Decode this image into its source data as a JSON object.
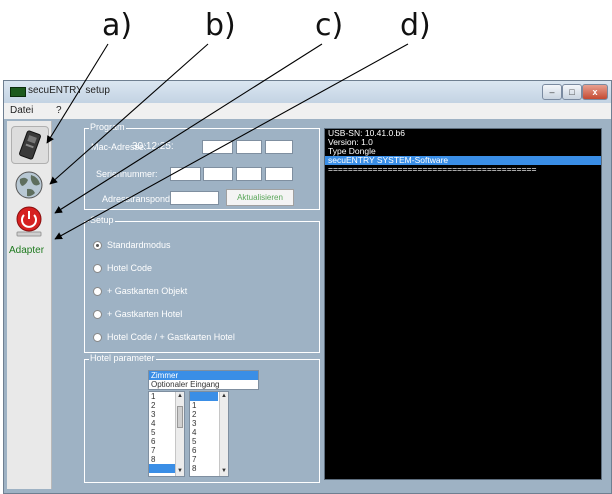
{
  "callouts": [
    "a)",
    "b)",
    "c)",
    "d)"
  ],
  "window": {
    "title": "secuENTRY setup",
    "min_label": "–",
    "max_label": "□",
    "close_label": "x"
  },
  "menu": [
    "Datei",
    "?"
  ],
  "sidebar": {
    "items": [
      {
        "icon": "dongle-icon"
      },
      {
        "icon": "globe-icon"
      },
      {
        "icon": "power-icon"
      }
    ],
    "label": "Adapter"
  },
  "programming": {
    "title": "Program",
    "mac_label": "Mac-Adresse:",
    "mac_value": "30:12:25:",
    "serial_label": "Seriennummer:",
    "transponder_label": "Adresstransponder",
    "read_button": "Aktualisieren"
  },
  "setup": {
    "title": "Setup",
    "options": [
      {
        "label": "Standardmodus",
        "checked": true
      },
      {
        "label": "Hotel Code",
        "checked": false
      },
      {
        "label": "+ Gastkarten Objekt",
        "checked": false
      },
      {
        "label": "+ Gastkarten Hotel",
        "checked": false
      },
      {
        "label": "Hotel Code / + Gastkarten Hotel",
        "checked": false
      }
    ]
  },
  "hotel": {
    "title": "Hotel parameter",
    "options": [
      "Zimmer",
      "Optionaler Eingang"
    ],
    "selected_option": "Zimmer",
    "list1": [
      "1",
      "2",
      "3",
      "4",
      "5",
      "6",
      "7",
      "8"
    ],
    "list2": [
      "1",
      "2",
      "3",
      "4",
      "5",
      "6",
      "7",
      "8"
    ]
  },
  "console": {
    "lines": [
      "USB-SN: 10.41.0.b6",
      "Version: 1.0",
      "Type Dongle",
      "secuENTRY SYSTEM-Software",
      "=========================================="
    ],
    "highlighted_index": 3
  }
}
